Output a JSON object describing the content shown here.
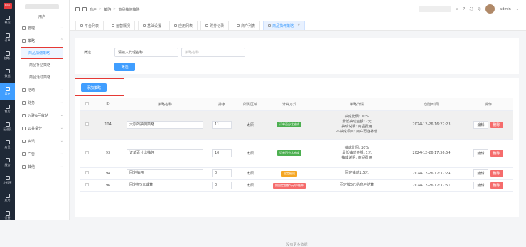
{
  "rail": {
    "logo": "国内外",
    "items": [
      {
        "label": "概况",
        "icon": "home-icon"
      },
      {
        "label": "订单",
        "icon": "order-icon"
      },
      {
        "label": "电商计",
        "icon": "mall-icon"
      },
      {
        "label": "数据",
        "icon": "data-icon"
      },
      {
        "label": "用户",
        "icon": "user-icon"
      },
      {
        "label": "售后",
        "icon": "service-icon"
      },
      {
        "label": "配送员",
        "icon": "delivery-icon"
      },
      {
        "label": "店员",
        "icon": "clerk-icon"
      },
      {
        "label": "服务",
        "icon": "service2-icon"
      },
      {
        "label": "小程序",
        "icon": "miniapp-icon"
      },
      {
        "label": "应用",
        "icon": "app-icon"
      },
      {
        "label": "设置",
        "icon": "settings-icon"
      }
    ],
    "active_index": 4
  },
  "sidebar": {
    "title": "用户",
    "groups": [
      {
        "label": "管理"
      },
      {
        "label": "策略"
      },
      {
        "label": "活动"
      },
      {
        "label": "财务"
      },
      {
        "label": "入驻&回收站"
      },
      {
        "label": "公共桌分"
      },
      {
        "label": "资讯"
      },
      {
        "label": "广告"
      },
      {
        "label": "其他"
      }
    ],
    "subs": [
      {
        "label": "商品抽佣策略"
      },
      {
        "label": "商品补贴策略"
      },
      {
        "label": "商品活动策略"
      }
    ]
  },
  "topbar": {
    "crumbs": [
      "商户",
      "策略",
      "商品抽佣策略"
    ],
    "user": "admin"
  },
  "tabs": [
    {
      "label": "平台列表"
    },
    {
      "label": "运营概况"
    },
    {
      "label": "基础设置"
    },
    {
      "label": "应用列表"
    },
    {
      "label": "购券记录"
    },
    {
      "label": "商户列表"
    },
    {
      "label": "商品抽佣策略",
      "close": "×"
    }
  ],
  "filter": {
    "label": "筛选",
    "input1_value": "请输入代理名称",
    "input2_placeholder": "策略名称",
    "button": "筛选"
  },
  "actions": {
    "add": "添加策略"
  },
  "table": {
    "headers": [
      "ID",
      "策略名称",
      "排序",
      "所属区域",
      "计算方式",
      "策略详情",
      "创建时间",
      "操作"
    ],
    "rows": [
      {
        "id": "104",
        "name": "太原的抽佣策略",
        "sort": "11",
        "region": "太原",
        "method": "订单百分比抽成",
        "method_color": "green",
        "detail": [
          "抽成比例: 10%",
          "最低抽成金额: 2元",
          "抽成说明: 商品费用",
          "不抽成项目: 商户再送补偿"
        ],
        "time": "2024-12-26 16:22:23"
      },
      {
        "id": "93",
        "name": "订单百分比抽佣",
        "sort": "10",
        "region": "太原",
        "method": "订单百分比抽成",
        "method_color": "green",
        "detail": [
          "抽成比例: 20%",
          "最低抽成金额: 1元",
          "抽成说明: 商品费用"
        ],
        "time": "2024-12-26 17:36:54"
      },
      {
        "id": "94",
        "name": "固定抽佣",
        "sort": "0",
        "region": "太原",
        "method": "固定抽成",
        "method_color": "orange",
        "detail": [
          "固定抽成1.5元"
        ],
        "time": "2024-12-26 17:37:24"
      },
      {
        "id": "96",
        "name": "固定按5元或算",
        "sort": "0",
        "region": "太原",
        "method": "按固定金额5元/户结算",
        "method_color": "red",
        "detail": [
          "固定按5元给商户结算"
        ],
        "time": "2024-12-26 17:37:51"
      }
    ],
    "edit_label": "编辑",
    "delete_label": "删除"
  },
  "footer": "没有更多数据"
}
